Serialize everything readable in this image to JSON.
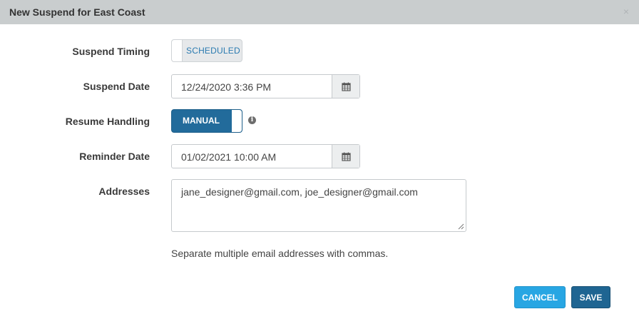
{
  "dialog": {
    "title": "New Suspend for East Coast",
    "close_glyph": "×"
  },
  "form": {
    "suspend_timing": {
      "label": "Suspend Timing",
      "value": "SCHEDULED"
    },
    "suspend_date": {
      "label": "Suspend Date",
      "value": "12/24/2020 3:36 PM"
    },
    "resume_handling": {
      "label": "Resume Handling",
      "value": "MANUAL"
    },
    "reminder_date": {
      "label": "Reminder Date",
      "value": "01/02/2021 10:00 AM"
    },
    "addresses": {
      "label": "Addresses",
      "value": "jane_designer@gmail.com, joe_designer@gmail.com",
      "help": "Separate multiple email addresses with commas."
    }
  },
  "buttons": {
    "cancel": "CANCEL",
    "save": "SAVE"
  },
  "colors": {
    "titlebar": "#c9cdce",
    "toggle_on": "#226b9b",
    "cancel": "#28a6e3",
    "save": "#1f6592",
    "link_text": "#2a7ab0"
  },
  "icons": {
    "calendar": "calendar-icon",
    "info": "info-icon",
    "close": "close-icon"
  }
}
